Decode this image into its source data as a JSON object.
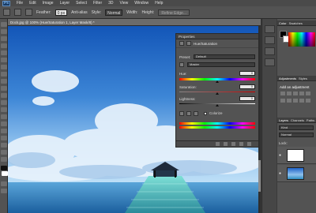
{
  "menu": {
    "logo": "Ps",
    "items": [
      "File",
      "Edit",
      "Image",
      "Layer",
      "Select",
      "Filter",
      "3D",
      "View",
      "Window",
      "Help"
    ]
  },
  "options": {
    "feather_label": "Feather:",
    "feather_value": "0 px",
    "anti_alias_label": "Anti-alias",
    "style_label": "Style:",
    "style_value": "Normal",
    "width_label": "Width:",
    "height_label": "Height:",
    "refine_edge": "Refine Edge..."
  },
  "document": {
    "tab_title": "Dock.jpg @ 100% (Hue/Saturation 1, Layer Mask/8) *"
  },
  "properties": {
    "title": "Properties",
    "subtitle": "Hue/Saturation",
    "preset_label": "Preset:",
    "preset_value": "Default",
    "channel_value": "Master",
    "hue_label": "Hue:",
    "hue_value": "0",
    "saturation_label": "Saturation:",
    "saturation_value": "0",
    "lightness_label": "Lightness:",
    "lightness_value": "0",
    "colorize_label": "Colorize"
  },
  "panels": {
    "color_tabs": [
      "Color",
      "Swatches"
    ],
    "adjust_tabs": [
      "Adjustments",
      "Styles"
    ],
    "add_adjustment": "Add an adjustment",
    "layers_tabs": [
      "Layers",
      "Channels",
      "Paths"
    ],
    "kind_value": "Kind",
    "blend_value": "Normal",
    "lock_label": "Lock:"
  },
  "colors": {
    "accent": "#1b3d66",
    "sky_top": "#1e63c8",
    "sea": "#2f8fc4"
  }
}
